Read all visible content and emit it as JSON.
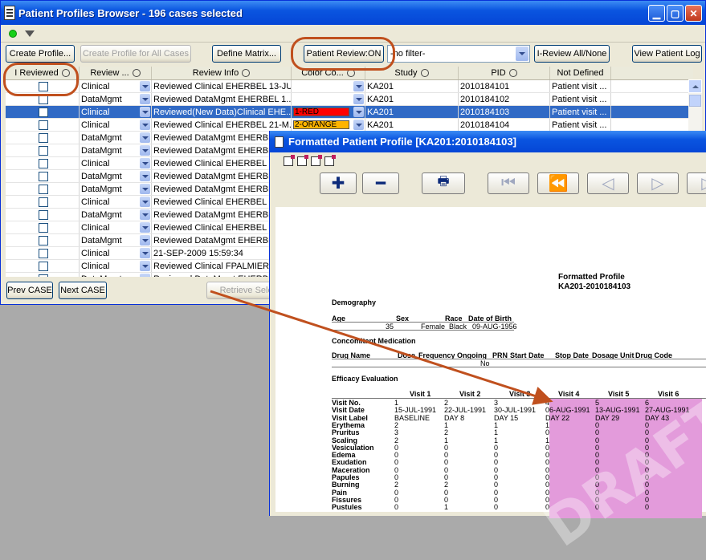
{
  "window": {
    "title": "Patient Profiles Browser - 196 cases selected"
  },
  "toolbar": {
    "create_profile": "Create Profile...",
    "create_all": "Create Profile for All Cases",
    "define_matrix": "Define Matrix...",
    "patient_review": "Patient Review:ON",
    "filter_value": "-no filter-",
    "ireview_all": "I-Review All/None",
    "view_log": "View Patient Log"
  },
  "table": {
    "columns": [
      "I Reviewed",
      "Review ...",
      "Review Info",
      "Color Co...",
      "Study",
      "PID",
      "Not Defined"
    ],
    "rows": [
      {
        "type": "Clinical",
        "info": "Reviewed Clinical EHERBEL 13-JU...",
        "color": "",
        "study": "KA201",
        "pid": "2010184101",
        "nd": "Patient visit ..."
      },
      {
        "type": "DataMgmt",
        "info": "Reviewed DataMgmt EHERBEL 1...",
        "color": "",
        "study": "KA201",
        "pid": "2010184102",
        "nd": "Patient visit ..."
      },
      {
        "type": "Clinical",
        "info": "Reviewed(New Data)Clinical EHE...",
        "color": "1-RED",
        "study": "KA201",
        "pid": "2010184103",
        "nd": "Patient visit ..."
      },
      {
        "type": "Clinical",
        "info": "Reviewed Clinical EHERBEL 21-M...",
        "color": "2-ORANGE",
        "study": "KA201",
        "pid": "2010184104",
        "nd": "Patient visit ..."
      },
      {
        "type": "DataMgmt",
        "info": "Reviewed DataMgmt EHERBEL",
        "color": "",
        "study": "",
        "pid": "",
        "nd": ""
      },
      {
        "type": "DataMgmt",
        "info": "Reviewed DataMgmt EHERBEL",
        "color": "",
        "study": "",
        "pid": "",
        "nd": ""
      },
      {
        "type": "Clinical",
        "info": "Reviewed Clinical EHERBEL 2",
        "color": "",
        "study": "",
        "pid": "",
        "nd": ""
      },
      {
        "type": "DataMgmt",
        "info": "Reviewed DataMgmt EHERBEL",
        "color": "",
        "study": "",
        "pid": "",
        "nd": ""
      },
      {
        "type": "DataMgmt",
        "info": "Reviewed DataMgmt EHERBEL",
        "color": "",
        "study": "",
        "pid": "",
        "nd": ""
      },
      {
        "type": "Clinical",
        "info": "Reviewed Clinical EHERBEL 29",
        "color": "",
        "study": "",
        "pid": "",
        "nd": ""
      },
      {
        "type": "DataMgmt",
        "info": "Reviewed DataMgmt EHERBEL",
        "color": "",
        "study": "",
        "pid": "",
        "nd": ""
      },
      {
        "type": "Clinical",
        "info": "Reviewed Clinical EHERBEL 29",
        "color": "",
        "study": "",
        "pid": "",
        "nd": ""
      },
      {
        "type": "DataMgmt",
        "info": "Reviewed DataMgmt EHERBEL",
        "color": "",
        "study": "",
        "pid": "",
        "nd": ""
      },
      {
        "type": "Clinical",
        "info": "21-SEP-2009 15:59:34",
        "color": "",
        "study": "",
        "pid": "",
        "nd": ""
      },
      {
        "type": "Clinical",
        "info": "Reviewed Clinical FPALMIERI",
        "color": "",
        "study": "",
        "pid": "",
        "nd": ""
      },
      {
        "type": "DataMgmt",
        "info": "Reviewed DataMgmt EHERBEL",
        "color": "",
        "study": "",
        "pid": "",
        "nd": ""
      }
    ]
  },
  "bottom": {
    "prev": "Prev CASE",
    "next": "Next CASE",
    "retrieve": "Retrieve Selected"
  },
  "profile_window": {
    "title": "Formatted Patient Profile [KA201:2010184103]"
  },
  "profile": {
    "title1": "Formatted Profile",
    "title2": "KA201-2010184103",
    "demo_heading": "Demography",
    "demo_headers": [
      "Age",
      "Sex",
      "Race",
      "Date of Birth"
    ],
    "demo_values": [
      "35",
      "Female",
      "Black",
      "09-AUG-1956"
    ],
    "conmed_heading": "Concomitant Medication",
    "conmed_headers": [
      "Drug Name",
      "Dose",
      "Frequency",
      "Ongoing",
      "PRN",
      "Start Date",
      "Stop Date",
      "Dosage Unit",
      "Drug Code"
    ],
    "conmed_ongoing": "No",
    "eff_heading": "Efficacy Evaluation",
    "visits": [
      "Visit 1",
      "Visit 2",
      "Visit 3",
      "Visit 4",
      "Visit 5",
      "Visit 6"
    ],
    "eff_rows": [
      {
        "label": "Visit No.",
        "vals": [
          "1",
          "2",
          "3",
          "4",
          "5",
          "6"
        ]
      },
      {
        "label": "Visit Date",
        "vals": [
          "15-JUL-1991",
          "22-JUL-1991",
          "30-JUL-1991",
          "06-AUG-1991",
          "13-AUG-1991",
          "27-AUG-1991"
        ]
      },
      {
        "label": "Visit Label",
        "vals": [
          "BASELINE",
          "DAY 8",
          "DAY 15",
          "DAY 22",
          "DAY 29",
          "DAY 43"
        ]
      },
      {
        "label": "Erythema",
        "vals": [
          "2",
          "1",
          "1",
          "1",
          "0",
          "0"
        ]
      },
      {
        "label": "Pruritus",
        "vals": [
          "3",
          "2",
          "1",
          "0",
          "0",
          "0"
        ]
      },
      {
        "label": "Scaling",
        "vals": [
          "2",
          "1",
          "1",
          "1",
          "0",
          "0"
        ]
      },
      {
        "label": "Vesiculation",
        "vals": [
          "0",
          "0",
          "0",
          "0",
          "0",
          "0"
        ]
      },
      {
        "label": "Edema",
        "vals": [
          "0",
          "0",
          "0",
          "0",
          "0",
          "0"
        ]
      },
      {
        "label": "Exudation",
        "vals": [
          "0",
          "0",
          "0",
          "0",
          "0",
          "0"
        ]
      },
      {
        "label": "Maceration",
        "vals": [
          "0",
          "0",
          "0",
          "0",
          "0",
          "0"
        ]
      },
      {
        "label": "Papules",
        "vals": [
          "0",
          "0",
          "0",
          "0",
          "0",
          "0"
        ]
      },
      {
        "label": "Burning",
        "vals": [
          "2",
          "2",
          "0",
          "0",
          "0",
          "0"
        ]
      },
      {
        "label": "Pain",
        "vals": [
          "0",
          "0",
          "0",
          "0",
          "0",
          "0"
        ]
      },
      {
        "label": "Fissures",
        "vals": [
          "0",
          "0",
          "0",
          "0",
          "0",
          "0"
        ]
      },
      {
        "label": "Pustules",
        "vals": [
          "0",
          "1",
          "0",
          "0",
          "0",
          "0"
        ]
      }
    ]
  },
  "colors": {
    "accent": "#316ac5",
    "annotation": "#c0501e",
    "highlight": "#e39bdb",
    "red_tag": "#ff0000",
    "orange_tag": "#ffb400"
  },
  "icons": [
    "app-icon",
    "green-status-icon",
    "filter-funnel-icon",
    "sort-icon",
    "dropdown-arrow-icon",
    "zoom-in-icon",
    "zoom-out-icon",
    "print-icon",
    "first-page-icon",
    "prev-fast-icon",
    "prev-page-icon",
    "next-page-icon"
  ]
}
